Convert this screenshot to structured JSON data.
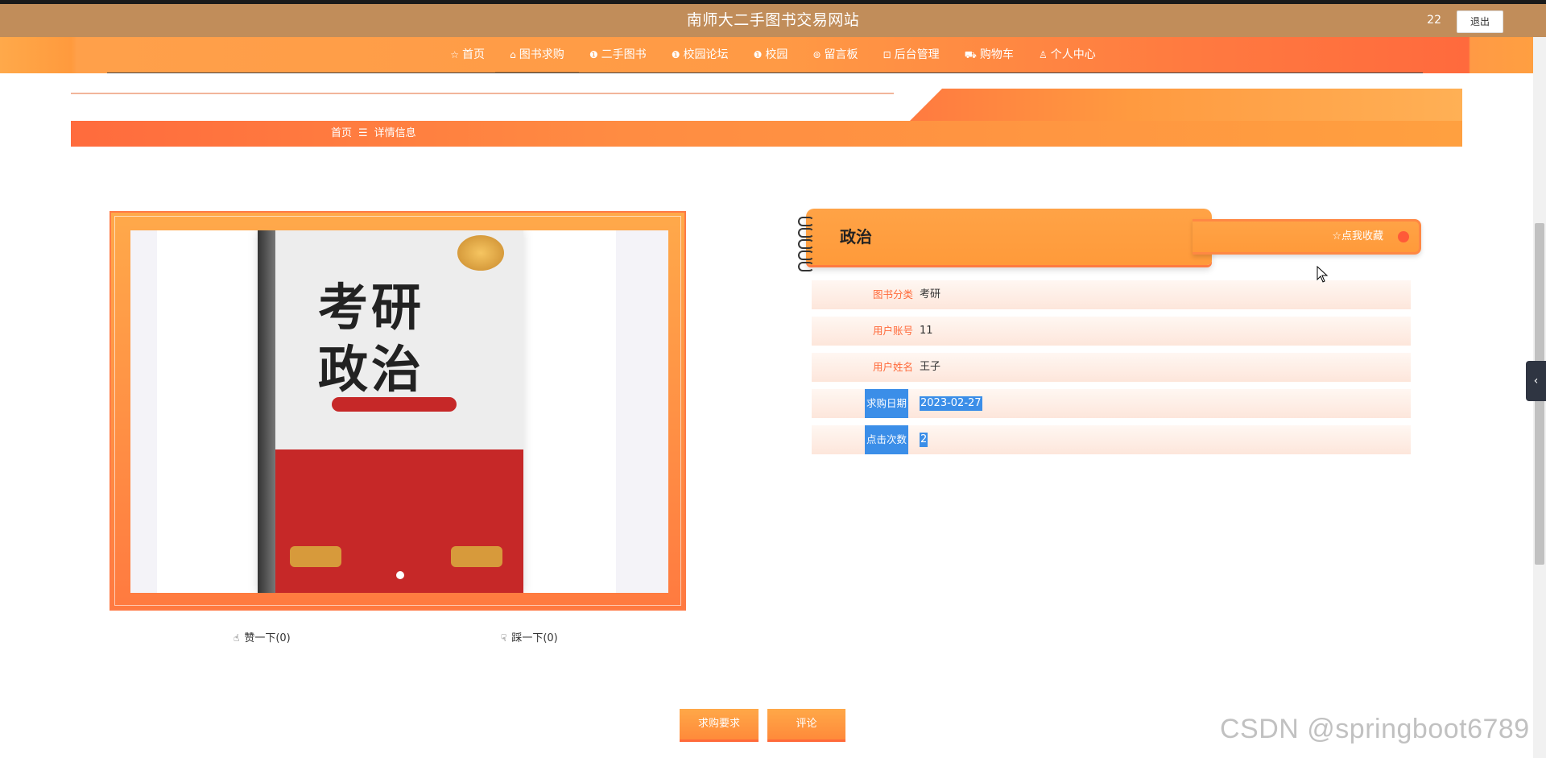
{
  "header": {
    "site_title": "南师大二手图书交易网站",
    "user_number": "22",
    "logout_label": "退出"
  },
  "nav": {
    "items": [
      {
        "label": "首页",
        "icon": "☆"
      },
      {
        "label": "图书求购",
        "icon": "⌂"
      },
      {
        "label": "二手图书",
        "icon": "❶"
      },
      {
        "label": "校园论坛",
        "icon": "❶"
      },
      {
        "label": "校园",
        "icon": "❶"
      },
      {
        "label": "留言板",
        "icon": "⊚"
      },
      {
        "label": "后台管理",
        "icon": "⊡"
      },
      {
        "label": "购物车",
        "icon": "⛟"
      },
      {
        "label": "个人中心",
        "icon": "♙"
      }
    ]
  },
  "breadcrumb": {
    "home": "首页",
    "separator": "☰",
    "current": "详情信息"
  },
  "cover": {
    "title_line1": "考研",
    "title_line2": "政治"
  },
  "votes": {
    "like_label": "赞一下(0)",
    "dislike_label": "踩一下(0)",
    "like_icon": "👍",
    "dislike_icon": "👎"
  },
  "detail": {
    "name": "政治",
    "collect_label": "☆点我收藏",
    "fields": [
      {
        "label": "图书分类",
        "value": "考研"
      },
      {
        "label": "用户账号",
        "value": "11"
      },
      {
        "label": "用户姓名",
        "value": "王子"
      },
      {
        "label": "求购日期",
        "value": "2023-02-27"
      },
      {
        "label": "点击次数",
        "value": "2"
      }
    ]
  },
  "actions": {
    "requirement_label": "求购要求",
    "comment_label": "评论"
  },
  "side_tab_icon": "‹",
  "watermark": "CSDN @springboot6789"
}
